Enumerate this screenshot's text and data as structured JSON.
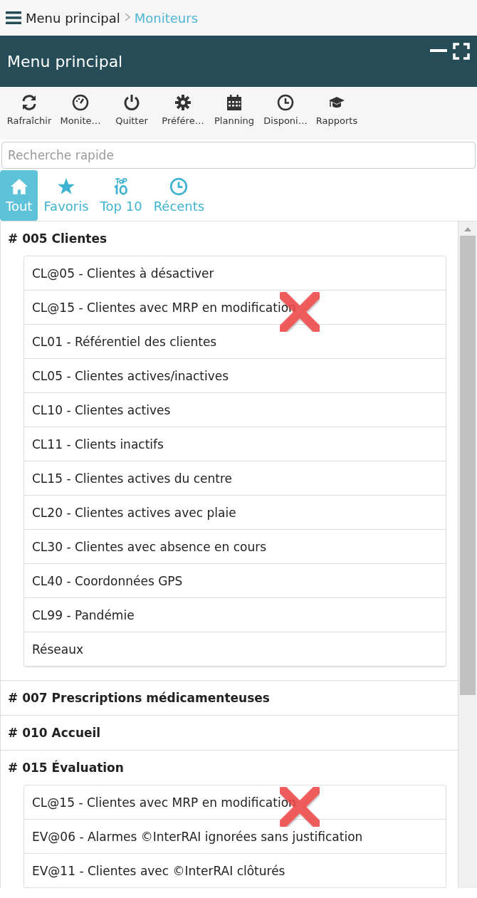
{
  "breadcrumb": {
    "items": [
      {
        "label": "Menu principal",
        "current": false
      },
      {
        "label": "Moniteurs",
        "current": true
      }
    ]
  },
  "panel": {
    "title": "Menu principal"
  },
  "toolbar": [
    {
      "kind": "refresh",
      "label": "Rafraîchir"
    },
    {
      "kind": "gauge",
      "label": "Monite…"
    },
    {
      "kind": "power",
      "label": "Quitter"
    },
    {
      "kind": "gear",
      "label": "Préfére…"
    },
    {
      "kind": "calendar",
      "label": "Planning"
    },
    {
      "kind": "clock",
      "label": "Disponi…"
    },
    {
      "kind": "cap",
      "label": "Rapports"
    }
  ],
  "search": {
    "placeholder": "Recherche rapide"
  },
  "tabs": [
    {
      "kind": "home",
      "label": "Tout",
      "selected": true
    },
    {
      "kind": "star",
      "label": "Favoris",
      "selected": false
    },
    {
      "kind": "top",
      "label": "Top 10",
      "selected": false
    },
    {
      "kind": "clock",
      "label": "Récents",
      "selected": false
    }
  ],
  "sections": [
    {
      "title": "# 005 Clientes",
      "items": [
        {
          "label": "CL@05 - Clientes à désactiver",
          "crossed": false
        },
        {
          "label": "CL@15 - Clientes avec MRP en modification",
          "crossed": true
        },
        {
          "label": "CL01 - Référentiel des clientes",
          "crossed": false
        },
        {
          "label": "CL05 - Clientes actives/inactives",
          "crossed": false
        },
        {
          "label": "CL10 - Clientes actives",
          "crossed": false
        },
        {
          "label": "CL11 - Clients inactifs",
          "crossed": false
        },
        {
          "label": "CL15 - Clientes actives du centre",
          "crossed": false
        },
        {
          "label": "CL20 - Clientes actives avec plaie",
          "crossed": false
        },
        {
          "label": "CL30 - Clientes avec absence en cours",
          "crossed": false
        },
        {
          "label": "CL40 - Coordonnées GPS",
          "crossed": false
        },
        {
          "label": "CL99 - Pandémie",
          "crossed": false
        },
        {
          "label": "Réseaux",
          "crossed": false
        }
      ]
    },
    {
      "title": "# 007 Prescriptions médicamenteuses"
    },
    {
      "title": "# 010 Accueil"
    },
    {
      "title": "# 015 Évaluation",
      "items": [
        {
          "label": "CL@15 - Clientes avec MRP en modification",
          "crossed": true
        },
        {
          "label": "EV@06 - Alarmes ©InterRAI ignorées sans justification",
          "crossed": false
        },
        {
          "label": "EV@11 - Clientes avec ©InterRAI clôturés",
          "crossed": false
        }
      ]
    }
  ]
}
